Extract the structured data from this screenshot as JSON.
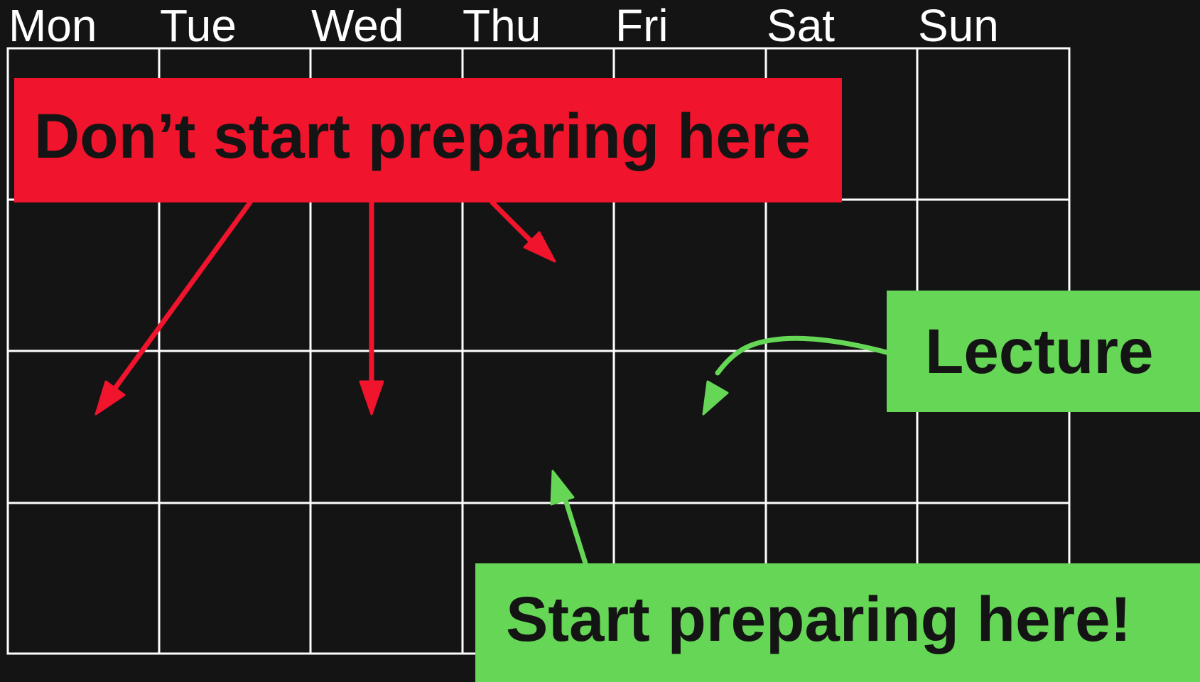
{
  "calendar": {
    "days": [
      "Mon",
      "Tue",
      "Wed",
      "Thu",
      "Fri",
      "Sat",
      "Sun"
    ],
    "weeks": 4
  },
  "callouts": {
    "dont_start": {
      "text": "Don’t start preparing here"
    },
    "lecture": {
      "text": "Lecture"
    },
    "start_here": {
      "text": "Start preparing here!"
    }
  },
  "colors": {
    "background": "#141414",
    "grid": "#ffffff",
    "warning": "#f0142d",
    "positive": "#65d655",
    "label_text": "#141414"
  }
}
